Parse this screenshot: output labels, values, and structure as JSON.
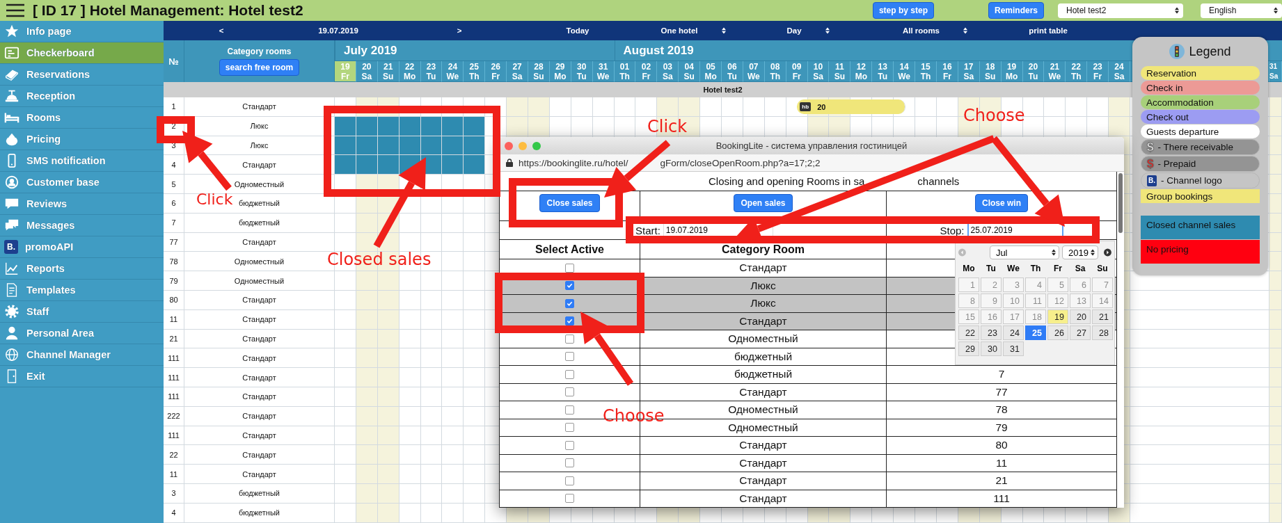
{
  "app": {
    "title": "[ ID 17 ] Hotel Management: Hotel test2"
  },
  "top_buttons": [
    "step by step",
    "Reminders"
  ],
  "hotel_select": {
    "value": "Hotel test2"
  },
  "language_select": {
    "value": "English"
  },
  "sidebar": {
    "items": [
      {
        "label": "Info page",
        "selected": false
      },
      {
        "label": "Checkerboard",
        "selected": true
      },
      {
        "label": "Reservations",
        "selected": false
      },
      {
        "label": "Reception",
        "selected": false
      },
      {
        "label": "Rooms",
        "selected": false
      },
      {
        "label": "Pricing",
        "selected": false
      },
      {
        "label": "SMS notification",
        "selected": false
      },
      {
        "label": "Customer base",
        "selected": false
      },
      {
        "label": "Reviews",
        "selected": false
      },
      {
        "label": "Messages",
        "selected": false
      },
      {
        "label": "promoAPI",
        "selected": false,
        "badge": "B."
      },
      {
        "label": "Reports",
        "selected": false
      },
      {
        "label": "Templates",
        "selected": false
      },
      {
        "label": "Staff",
        "selected": false
      },
      {
        "label": "Personal Area",
        "selected": false
      },
      {
        "label": "Channel Manager",
        "selected": false
      },
      {
        "label": "Exit",
        "selected": false
      }
    ]
  },
  "nav": {
    "prev": "<",
    "date": "19.07.2019",
    "next": ">",
    "today": "Today",
    "selects": [
      "One hotel",
      "Day",
      "All rooms"
    ],
    "print": "print table"
  },
  "grid": {
    "number_header": "№",
    "category_header": "Category rooms",
    "search_button": "search free room",
    "months": [
      {
        "label": "July 2019",
        "days": [
          {
            "day": "19",
            "weekday": "Fr",
            "weekend": false,
            "today": true,
            "closed_sales": true,
            "booked": false
          },
          {
            "day": "20",
            "weekday": "Sa",
            "weekend": true,
            "today": false,
            "closed_sales": true,
            "booked": false
          },
          {
            "day": "21",
            "weekday": "Su",
            "weekend": true,
            "today": false,
            "closed_sales": true,
            "booked": false
          },
          {
            "day": "22",
            "weekday": "Mo",
            "weekend": false,
            "today": false,
            "closed_sales": true,
            "booked": false
          },
          {
            "day": "23",
            "weekday": "Tu",
            "weekend": false,
            "today": false,
            "closed_sales": true,
            "booked": false
          },
          {
            "day": "24",
            "weekday": "We",
            "weekend": false,
            "today": false,
            "closed_sales": true,
            "booked": false
          },
          {
            "day": "25",
            "weekday": "Th",
            "weekend": false,
            "today": false,
            "closed_sales": true,
            "booked": false
          },
          {
            "day": "26",
            "weekday": "Fr",
            "weekend": false,
            "today": false,
            "closed_sales": false,
            "booked": false
          },
          {
            "day": "27",
            "weekday": "Sa",
            "weekend": true,
            "today": false,
            "closed_sales": false,
            "booked": false
          },
          {
            "day": "28",
            "weekday": "Su",
            "weekend": true,
            "today": false,
            "closed_sales": false,
            "booked": false
          },
          {
            "day": "29",
            "weekday": "Mo",
            "weekend": false,
            "today": false,
            "closed_sales": false,
            "booked": false
          },
          {
            "day": "30",
            "weekday": "Tu",
            "weekend": false,
            "today": false,
            "closed_sales": false,
            "booked": false
          },
          {
            "day": "31",
            "weekday": "We",
            "weekend": false,
            "today": false,
            "closed_sales": false,
            "booked": false
          }
        ]
      },
      {
        "label": "August 2019",
        "days": [
          {
            "day": "01",
            "weekday": "Th",
            "weekend": false,
            "today": false,
            "closed_sales": false,
            "booked": false
          },
          {
            "day": "02",
            "weekday": "Fr",
            "weekend": false,
            "today": false,
            "closed_sales": false,
            "booked": false
          },
          {
            "day": "03",
            "weekday": "Sa",
            "weekend": true,
            "today": false,
            "closed_sales": false,
            "booked": false
          },
          {
            "day": "04",
            "weekday": "Su",
            "weekend": true,
            "today": false,
            "closed_sales": false,
            "booked": false
          },
          {
            "day": "05",
            "weekday": "Mo",
            "weekend": false,
            "today": false,
            "closed_sales": false,
            "booked": false
          },
          {
            "day": "06",
            "weekday": "Tu",
            "weekend": false,
            "today": false,
            "closed_sales": false,
            "booked": false
          },
          {
            "day": "07",
            "weekday": "We",
            "weekend": false,
            "today": false,
            "closed_sales": false,
            "booked": false
          },
          {
            "day": "08",
            "weekday": "Th",
            "weekend": false,
            "today": false,
            "closed_sales": false,
            "booked": false
          },
          {
            "day": "09",
            "weekday": "Fr",
            "weekend": false,
            "today": false,
            "closed_sales": false,
            "booked": true
          },
          {
            "day": "10",
            "weekday": "Sa",
            "weekend": true,
            "today": false,
            "closed_sales": false,
            "booked": true
          },
          {
            "day": "11",
            "weekday": "Su",
            "weekend": true,
            "today": false,
            "closed_sales": false,
            "booked": true
          },
          {
            "day": "12",
            "weekday": "Mo",
            "weekend": false,
            "today": false,
            "closed_sales": false,
            "booked": true
          },
          {
            "day": "13",
            "weekday": "Tu",
            "weekend": false,
            "today": false,
            "closed_sales": false,
            "booked": true
          },
          {
            "day": "14",
            "weekday": "We",
            "weekend": false,
            "today": false,
            "closed_sales": false,
            "booked": true
          },
          {
            "day": "15",
            "weekday": "Th",
            "weekend": false,
            "today": false,
            "closed_sales": false,
            "booked": false
          },
          {
            "day": "16",
            "weekday": "Fr",
            "weekend": false,
            "today": false,
            "closed_sales": false,
            "booked": false
          },
          {
            "day": "17",
            "weekday": "Sa",
            "weekend": true,
            "today": false,
            "closed_sales": false,
            "booked": false
          },
          {
            "day": "18",
            "weekday": "Su",
            "weekend": true,
            "today": false,
            "closed_sales": false,
            "booked": false
          },
          {
            "day": "19",
            "weekday": "Mo",
            "weekend": false,
            "today": false,
            "closed_sales": false,
            "booked": false
          },
          {
            "day": "20",
            "weekday": "Tu",
            "weekend": false,
            "today": false,
            "closed_sales": false,
            "booked": false
          },
          {
            "day": "21",
            "weekday": "We",
            "weekend": false,
            "today": false,
            "closed_sales": false,
            "booked": false
          },
          {
            "day": "22",
            "weekday": "Th",
            "weekend": false,
            "today": false,
            "closed_sales": false,
            "booked": false
          },
          {
            "day": "23",
            "weekday": "Fr",
            "weekend": false,
            "today": false,
            "closed_sales": false,
            "booked": false
          },
          {
            "day": "24",
            "weekday": "Sa",
            "weekend": true,
            "today": false,
            "closed_sales": false,
            "booked": false
          }
        ]
      }
    ],
    "last_day": {
      "day": "31",
      "weekday": "Sa",
      "weekend": true
    },
    "hotel_label": "Hotel test2",
    "rows": [
      {
        "number": "1",
        "category": "Стандарт",
        "closed": false,
        "booking": {
          "badge": "hb",
          "label": "20"
        }
      },
      {
        "number": "2",
        "category": "Люкс",
        "closed": true
      },
      {
        "number": "3",
        "category": "Люкс",
        "closed": true
      },
      {
        "number": "4",
        "category": "Стандарт",
        "closed": true
      },
      {
        "number": "5",
        "category": "Одноместный",
        "closed": false
      },
      {
        "number": "6",
        "category": "бюджетный",
        "closed": false
      },
      {
        "number": "7",
        "category": "бюджетный",
        "closed": false
      },
      {
        "number": "77",
        "category": "Стандарт",
        "closed": false
      },
      {
        "number": "78",
        "category": "Одноместный",
        "closed": false
      },
      {
        "number": "79",
        "category": "Одноместный",
        "closed": false
      },
      {
        "number": "80",
        "category": "Стандарт",
        "closed": false
      },
      {
        "number": "11",
        "category": "Стандарт",
        "closed": false
      },
      {
        "number": "21",
        "category": "Стандарт",
        "closed": false
      },
      {
        "number": "111",
        "category": "Стандарт",
        "closed": false
      },
      {
        "number": "111",
        "category": "Стандарт",
        "closed": false
      },
      {
        "number": "111",
        "category": "Стандарт",
        "closed": false
      },
      {
        "number": "222",
        "category": "Стандарт",
        "closed": false
      },
      {
        "number": "111",
        "category": "Стандарт",
        "closed": false
      },
      {
        "number": "22",
        "category": "Стандарт",
        "closed": false
      },
      {
        "number": "11",
        "category": "Стандарт",
        "closed": false
      },
      {
        "number": "3",
        "category": "бюджетный",
        "closed": false
      },
      {
        "number": "4",
        "category": "бюджетный",
        "closed": false
      }
    ]
  },
  "legend": {
    "title": "Legend",
    "items": [
      {
        "kind": "pill",
        "label": "Reservation",
        "color": "#f0e67a"
      },
      {
        "kind": "pill",
        "label": "Check in",
        "color": "#ec9a96"
      },
      {
        "kind": "pill",
        "label": "Accommodation",
        "color": "#a8d07a"
      },
      {
        "kind": "pill",
        "label": "Check out",
        "color": "#9c9cf2"
      },
      {
        "kind": "pill",
        "label": "Guests departure",
        "color": "#ffffff"
      },
      {
        "kind": "symbol",
        "symbol": "$",
        "label": "- There receivable",
        "color": "#f4f4f4"
      },
      {
        "kind": "symbol",
        "symbol": "$",
        "label": "- Prepaid",
        "color": "#e2201c"
      },
      {
        "kind": "logo",
        "symbol": "B.",
        "label": "- Channel logo",
        "color": "#1d3f8e"
      },
      {
        "kind": "band",
        "label": "Group bookings",
        "color": "#f0e67a"
      },
      {
        "kind": "block",
        "label": "Closed channel sales",
        "color": "#2e8bb0"
      },
      {
        "kind": "block",
        "label": "No pricing",
        "color": "#ff0010"
      }
    ]
  },
  "popup": {
    "window_title": "BookingLite - система управления гостиницей",
    "url_start": "https://bookinglite.ru/hotel/",
    "url_end": "gForm/closeOpenRoom.php?a=17;2;2",
    "heading": [
      "Closing and opening Rooms in sa",
      "channels"
    ],
    "buttons": [
      "Close sales",
      "Open sales",
      "Close win"
    ],
    "start": {
      "label": "Start:",
      "value": "19.07.2019"
    },
    "stop": {
      "label": "Stop:",
      "value": "25.07.2019"
    },
    "columns": [
      "Select Active",
      "Category Room"
    ],
    "rows": [
      {
        "checked": false,
        "category": "Стандарт"
      },
      {
        "checked": true,
        "category": "Люкс"
      },
      {
        "checked": true,
        "category": "Люкс"
      },
      {
        "checked": true,
        "category": "Стандарт"
      },
      {
        "checked": false,
        "category": "Одноместный"
      },
      {
        "checked": false,
        "category": "бюджетный"
      },
      {
        "checked": false,
        "category": "бюджетный",
        "number": "7"
      },
      {
        "checked": false,
        "category": "Стандарт",
        "number": "77"
      },
      {
        "checked": false,
        "category": "Одноместный",
        "number": "78"
      },
      {
        "checked": false,
        "category": "Одноместный",
        "number": "79"
      },
      {
        "checked": false,
        "category": "Стандарт",
        "number": "80"
      },
      {
        "checked": false,
        "category": "Стандарт",
        "number": "11"
      },
      {
        "checked": false,
        "category": "Стандарт",
        "number": "21"
      },
      {
        "checked": false,
        "category": "Стандарт",
        "number": "111"
      }
    ],
    "datepicker": {
      "month": "Jul",
      "year": "2019",
      "weekdays": [
        "Mo",
        "Tu",
        "We",
        "Th",
        "Fr",
        "Sa",
        "Su"
      ],
      "days": [
        {
          "label": "1",
          "disabled": true,
          "today": false,
          "selected": false
        },
        {
          "label": "2",
          "disabled": true,
          "today": false,
          "selected": false
        },
        {
          "label": "3",
          "disabled": true,
          "today": false,
          "selected": false
        },
        {
          "label": "4",
          "disabled": true,
          "today": false,
          "selected": false
        },
        {
          "label": "5",
          "disabled": true,
          "today": false,
          "selected": false
        },
        {
          "label": "6",
          "disabled": true,
          "today": false,
          "selected": false
        },
        {
          "label": "7",
          "disabled": true,
          "today": false,
          "selected": false
        },
        {
          "label": "8",
          "disabled": true,
          "today": false,
          "selected": false
        },
        {
          "label": "9",
          "disabled": true,
          "today": false,
          "selected": false
        },
        {
          "label": "10",
          "disabled": true,
          "today": false,
          "selected": false
        },
        {
          "label": "11",
          "disabled": true,
          "today": false,
          "selected": false
        },
        {
          "label": "12",
          "disabled": true,
          "today": false,
          "selected": false
        },
        {
          "label": "13",
          "disabled": true,
          "today": false,
          "selected": false
        },
        {
          "label": "14",
          "disabled": true,
          "today": false,
          "selected": false
        },
        {
          "label": "15",
          "disabled": true,
          "today": false,
          "selected": false
        },
        {
          "label": "16",
          "disabled": true,
          "today": false,
          "selected": false
        },
        {
          "label": "17",
          "disabled": true,
          "today": false,
          "selected": false
        },
        {
          "label": "18",
          "disabled": true,
          "today": false,
          "selected": false
        },
        {
          "label": "19",
          "disabled": false,
          "today": true,
          "selected": false
        },
        {
          "label": "20",
          "disabled": false,
          "today": false,
          "selected": false
        },
        {
          "label": "21",
          "disabled": false,
          "today": false,
          "selected": false
        },
        {
          "label": "22",
          "disabled": false,
          "today": false,
          "selected": false
        },
        {
          "label": "23",
          "disabled": false,
          "today": false,
          "selected": false
        },
        {
          "label": "24",
          "disabled": false,
          "today": false,
          "selected": false
        },
        {
          "label": "25",
          "disabled": false,
          "today": false,
          "selected": true
        },
        {
          "label": "26",
          "disabled": false,
          "today": false,
          "selected": false
        },
        {
          "label": "27",
          "disabled": false,
          "today": false,
          "selected": false
        },
        {
          "label": "28",
          "disabled": false,
          "today": false,
          "selected": false
        },
        {
          "label": "29",
          "disabled": false,
          "today": false,
          "selected": false
        },
        {
          "label": "30",
          "disabled": false,
          "today": false,
          "selected": false
        },
        {
          "label": "31",
          "disabled": false,
          "today": false,
          "selected": false
        }
      ]
    }
  },
  "annotations": {
    "labels": [
      "Click",
      "Closed sales",
      "Click",
      "Choose",
      "Choose"
    ]
  }
}
